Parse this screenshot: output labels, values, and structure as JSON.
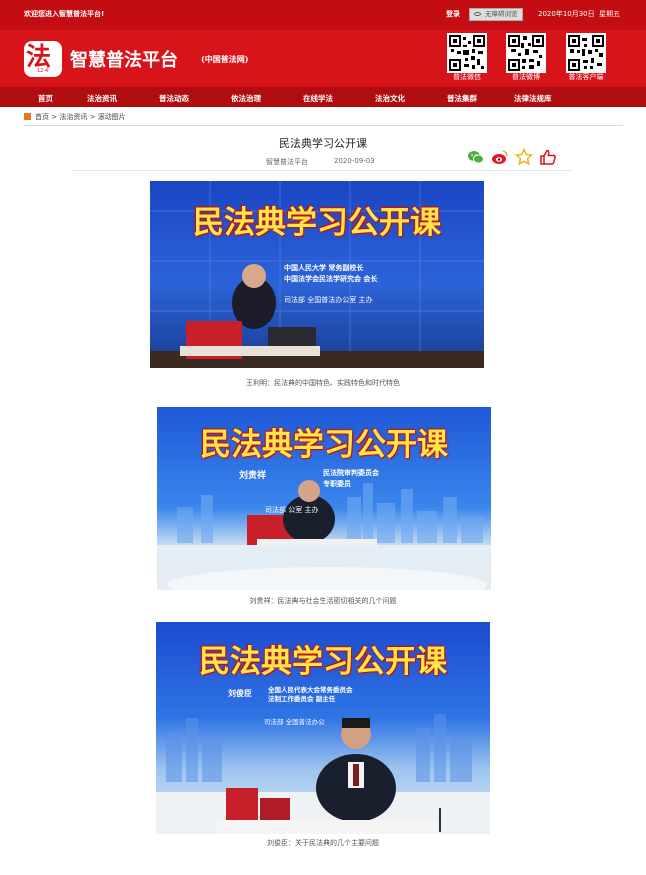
{
  "topbar": {
    "welcome": "欢迎您进入智慧普法平台!",
    "login": "登录",
    "accessibility": "无障碍浏览",
    "date": "2020年10月30日",
    "weekday": "星期五"
  },
  "header": {
    "logo_char": "法",
    "logo_sub": "12·4",
    "title": "智慧普法平台",
    "subtitle": "(中国普法网)",
    "qr_codes": [
      {
        "label": "普法微信"
      },
      {
        "label": "普法微博"
      },
      {
        "label": "普法客户端"
      }
    ]
  },
  "nav": {
    "items": [
      "首页",
      "法治资讯",
      "普法动态",
      "依法治理",
      "在线学法",
      "法治文化",
      "普法集群",
      "法律法规库"
    ]
  },
  "breadcrumb": {
    "home": "首页",
    "sep1": ">",
    "section": "法治资讯",
    "sep2": ">",
    "current": "滚动图片"
  },
  "article": {
    "title": "民法典学习公开课",
    "source": "智慧普法平台",
    "date": "2020-09-03"
  },
  "photos": [
    {
      "banner": "民法典学习公开课",
      "speaker_lines": [
        "中国人民大学 常务副校长",
        "中国法学会民法学研究会 会长"
      ],
      "host": "司法部 全国普法办公室  主办",
      "caption": "王利明：民法典的中国特色、实践特色和时代特色"
    },
    {
      "banner": "民法典学习公开课",
      "speaker_name": "刘贵祥",
      "speaker_lines": [
        "民法院审判委员会",
        "专职委员"
      ],
      "host": "司法部    公室  主办",
      "caption": "刘贵祥：民法典与社会生活密切相关的几个问题"
    },
    {
      "banner": "民法典学习公开课",
      "speaker_name": "刘俊臣",
      "speaker_lines": [
        "全国人民代表大会常务委员会",
        "法制工作委员会 副主任"
      ],
      "host": "司法部 全国普法办公",
      "caption": "刘俊臣：关于民法典的几个主要问题"
    }
  ],
  "colors": {
    "brand_red": "#d8141b",
    "nav_red": "#b00d10",
    "banner_yellow": "#ffe64a",
    "stage_blue": "#1d4fb3"
  },
  "icons": {
    "share": [
      "wechat-icon",
      "weibo-icon",
      "favorite-star-icon",
      "like-thumb-icon"
    ]
  }
}
